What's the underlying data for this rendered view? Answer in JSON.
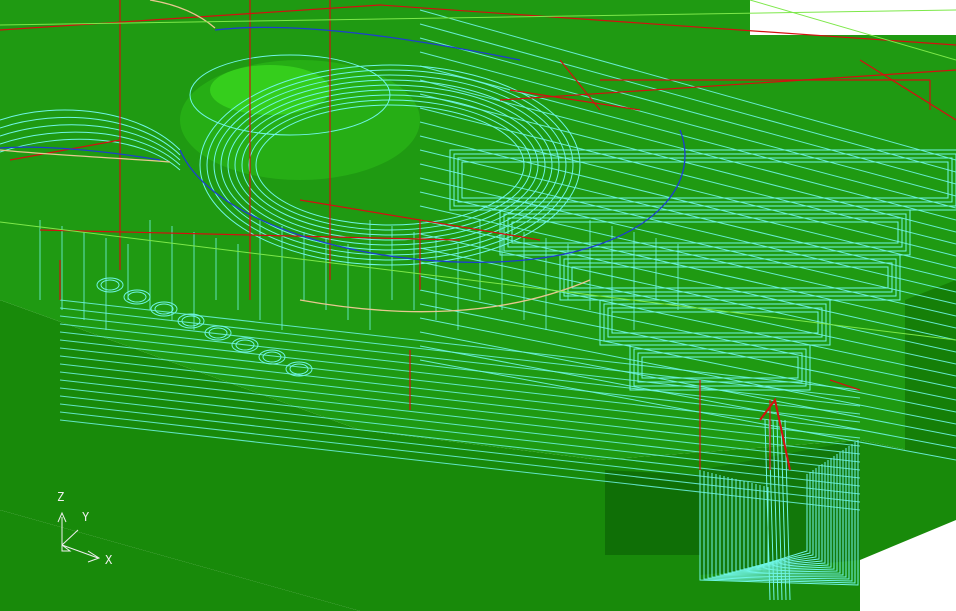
{
  "viewport": {
    "background_color": "#ffffff",
    "model_colors": {
      "top_face": "#1f9a12",
      "side_face": "#188a0a",
      "side_face_dark": "#0f6f06",
      "highlight": "#3ad61e"
    },
    "toolpath_colors": {
      "finishing": "#6ff5e6",
      "rapid_moves": "#d41010",
      "boundary": "#1d3fcf",
      "profile": "#e8c890",
      "stock_edge": "#7de84a"
    }
  },
  "axis_triad": {
    "z_label": "Z",
    "y_label": "Y",
    "x_label": "X",
    "color": "#f0f0f0",
    "icon": "axis-triad-icon"
  }
}
